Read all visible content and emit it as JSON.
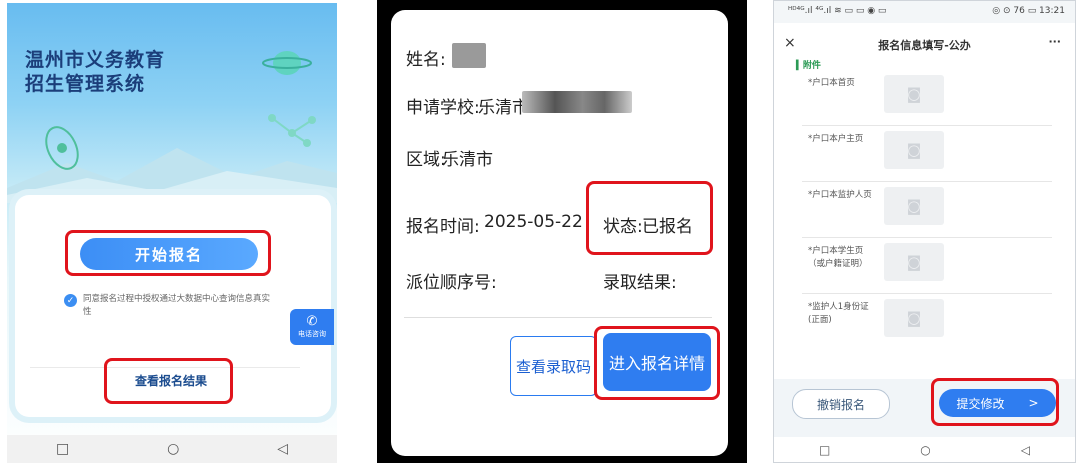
{
  "panel1": {
    "title_line1": "温州市义务教育",
    "title_line2": "招生管理系统",
    "start_button": "开始报名",
    "agree_text": "同意报名过程中授权通过大数据中心查询信息真实性",
    "phone_label": "电话咨询",
    "view_result": "查看报名结果",
    "nav": [
      "□",
      "○",
      "◁"
    ]
  },
  "panel2": {
    "name_label": "姓名:",
    "school_label": "申请学校:",
    "school_value": "乐清市",
    "area_label": "区域:",
    "area_value": "乐清市",
    "time_label": "报名时间:",
    "time_value": "2025-05-22",
    "status_label": "状态:",
    "status_value": "已报名",
    "order_label": "派位顺序号:",
    "result_label": "录取结果:",
    "btn_code": "查看录取码",
    "btn_detail": "进入报名详情"
  },
  "panel3": {
    "status_left": "ᴴᴰ⁴ᴳ.ıl ⁴ᴳ.ıl ≋ ▭ ▭ ◉ ▭",
    "status_right": "◎ ⊙ 76 ▭ 13:21",
    "close_icon": "×",
    "title": "报名信息填写-公办",
    "more": "···",
    "section": "附件",
    "rows": [
      {
        "label": "*户口本首页"
      },
      {
        "label": "*户口本户主页"
      },
      {
        "label": "*户口本监护人页"
      },
      {
        "label": "*户口本学生页（或户籍证明）"
      },
      {
        "label": "*监护人1身份证(正面)"
      }
    ],
    "btn_cancel": "撤销报名",
    "btn_submit": "提交修改",
    "btn_submit_arrow": ">",
    "nav": [
      "□",
      "○",
      "◁"
    ]
  },
  "colors": {
    "accent": "#2f7df0",
    "highlight": "#e0141c",
    "title": "#1b3e7a"
  }
}
